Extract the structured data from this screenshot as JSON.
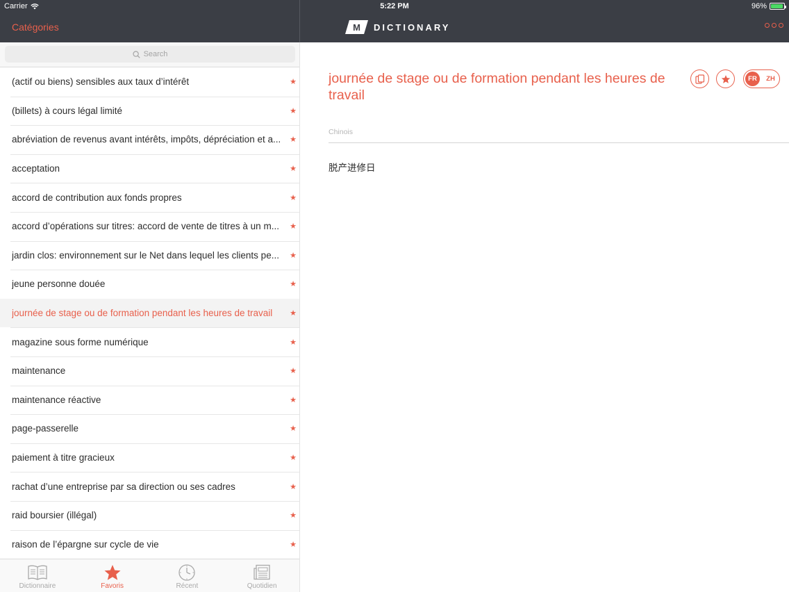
{
  "status_bar": {
    "carrier": "Carrier",
    "time": "5:22 PM",
    "battery": "96%",
    "battery_level": 0.96,
    "battery_color": "#4cd964"
  },
  "nav": {
    "back_label": "Catégories",
    "logo_letter": "M",
    "logo_text": "DICTIONARY",
    "more_icon": "more-circles-icon"
  },
  "search": {
    "placeholder": "Search",
    "icon": "search-icon"
  },
  "list": {
    "items": [
      {
        "label": "(actif ou biens) sensibles aux taux d’intérêt",
        "starred": true,
        "selected": false
      },
      {
        "label": "(billets) à cours légal limité",
        "starred": true,
        "selected": false
      },
      {
        "label": "abréviation de revenus avant intérêts, impôts, dépréciation et a...",
        "starred": true,
        "selected": false
      },
      {
        "label": "acceptation",
        "starred": true,
        "selected": false
      },
      {
        "label": "accord de contribution aux fonds propres",
        "starred": true,
        "selected": false
      },
      {
        "label": "accord d’opérations sur titres: accord de vente de titres à un m...",
        "starred": true,
        "selected": false
      },
      {
        "label": "jardin clos: environnement sur le Net dans lequel les clients pe...",
        "starred": true,
        "selected": false
      },
      {
        "label": "jeune personne douée",
        "starred": true,
        "selected": false
      },
      {
        "label": "journée de stage ou de formation pendant les heures de travail",
        "starred": true,
        "selected": true
      },
      {
        "label": "magazine sous forme numérique",
        "starred": true,
        "selected": false
      },
      {
        "label": "maintenance",
        "starred": true,
        "selected": false
      },
      {
        "label": "maintenance réactive",
        "starred": true,
        "selected": false
      },
      {
        "label": "page-passerelle",
        "starred": true,
        "selected": false
      },
      {
        "label": "paiement à titre gracieux",
        "starred": true,
        "selected": false
      },
      {
        "label": "rachat d’une entreprise par sa direction ou ses cadres",
        "starred": true,
        "selected": false
      },
      {
        "label": "raid boursier (illégal)",
        "starred": true,
        "selected": false
      },
      {
        "label": "raison de l’épargne sur cycle de vie",
        "starred": true,
        "selected": false
      }
    ]
  },
  "tabs": [
    {
      "label": "Dictionnaire",
      "icon": "book-icon",
      "active": false
    },
    {
      "label": "Favoris",
      "icon": "star-icon",
      "active": true
    },
    {
      "label": "Récent",
      "icon": "clock-icon",
      "active": false
    },
    {
      "label": "Quotidien",
      "icon": "newspaper-icon",
      "active": false
    }
  ],
  "detail": {
    "term": "journée de stage ou de formation pendant les heures de travail",
    "copy_icon": "copy-icon",
    "favorite_icon": "star-icon",
    "lang_from": "FR",
    "lang_to": "ZH",
    "section_label": "Chinois",
    "translation": "脱产进修日"
  },
  "colors": {
    "accent": "#e8604c",
    "topbar": "#3b3e45"
  }
}
